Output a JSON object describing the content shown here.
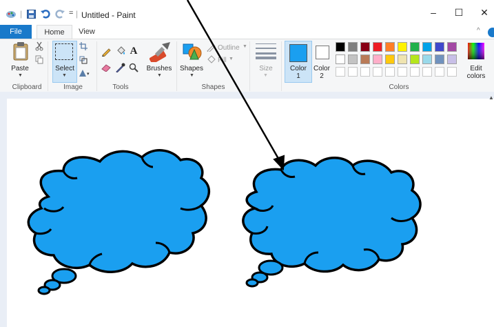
{
  "window": {
    "title": "Untitled - Paint",
    "minimize": "–",
    "maximize": "☐",
    "close": "✕",
    "qat_dropdown": "="
  },
  "tabs": {
    "file": "File",
    "home": "Home",
    "view": "View"
  },
  "ribbon": {
    "clipboard": {
      "paste": "Paste",
      "group": "Clipboard"
    },
    "image": {
      "select": "Select",
      "group": "Image"
    },
    "tools": {
      "group": "Tools",
      "text_tool": "A"
    },
    "brushes": {
      "label": "Brushes"
    },
    "shapes": {
      "label": "Shapes",
      "outline": "Outline",
      "fill": "Fill",
      "group": "Shapes"
    },
    "size": {
      "label": "Size"
    },
    "colors": {
      "color1": "Color",
      "color1_num": "1",
      "color2": "Color",
      "color2_num": "2",
      "edit1": "Edit",
      "edit2": "colors",
      "group": "Colors",
      "color1_value": "#1a9ff0",
      "color2_value": "#ffffff",
      "row1": [
        "#000000",
        "#7f7f7f",
        "#880015",
        "#ed1c24",
        "#ff7f27",
        "#fff200",
        "#22b14c",
        "#00a2e8",
        "#3f48cc",
        "#a349a4"
      ],
      "row2": [
        "#ffffff",
        "#c3c3c3",
        "#b97a57",
        "#ffaec9",
        "#ffc90e",
        "#efe4b0",
        "#b5e61d",
        "#99d9ea",
        "#7092be",
        "#c8bfe7"
      ]
    }
  },
  "canvas": {
    "cloud_fill": "#1a9ff0"
  }
}
